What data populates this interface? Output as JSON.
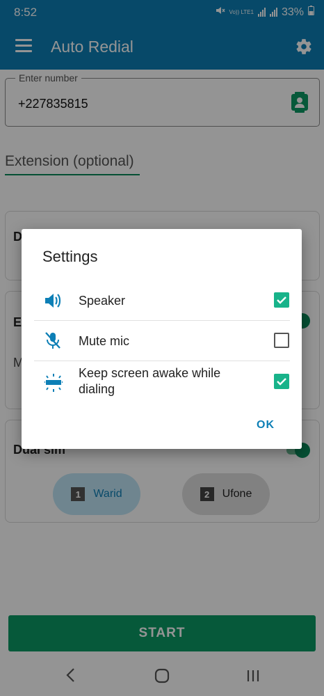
{
  "status_bar": {
    "time": "8:52",
    "network": "Vo)) LTE1",
    "battery": "33%"
  },
  "app_bar": {
    "title": "Auto Redial"
  },
  "phone_field": {
    "label": "Enter number",
    "value": "+227835815"
  },
  "extension_field": {
    "placeholder": "Extension (optional)"
  },
  "cards": {
    "card1_label": "D",
    "card2_label": "E",
    "card2_sub": "M",
    "dual_sim_label": "Dual sim"
  },
  "sims": [
    {
      "number": "1",
      "label": "Warid",
      "selected": true
    },
    {
      "number": "2",
      "label": "Ufone",
      "selected": false
    }
  ],
  "start_button": {
    "label": "START"
  },
  "dialog": {
    "title": "Settings",
    "options": [
      {
        "icon": "speaker-icon",
        "label": "Speaker",
        "checked": true
      },
      {
        "icon": "mic-off-icon",
        "label": "Mute mic",
        "checked": false
      },
      {
        "icon": "screen-awake-icon",
        "label": "Keep screen awake while dialing",
        "checked": true
      }
    ],
    "ok_label": "OK"
  },
  "colors": {
    "primary": "#0d7fb6",
    "accent": "#0c9a64",
    "checkbox": "#18b38a"
  }
}
